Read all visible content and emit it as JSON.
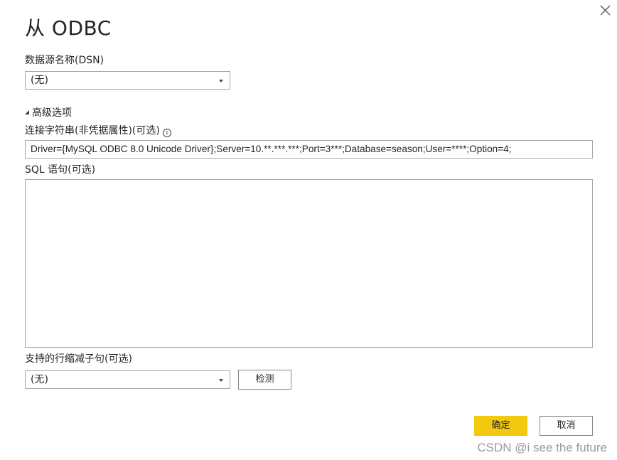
{
  "dialog": {
    "title": "从 ODBC",
    "close_icon": "close-icon"
  },
  "dsn": {
    "label": "数据源名称(DSN)",
    "selected": "(无)"
  },
  "advanced": {
    "toggle_label": "高级选项",
    "expanded": true,
    "connection_string": {
      "label": "连接字符串(非凭据属性)(可选)",
      "info_icon": "info-icon",
      "info_glyph": "i",
      "value": "Driver={MySQL ODBC 8.0 Unicode Driver};Server=10.**.***.***;Port=3***;Database=season;User=****;Option=4;"
    },
    "sql": {
      "label": "SQL 语句(可选)",
      "value": ""
    },
    "row_reduction": {
      "label": "支持的行缩减子句(可选)",
      "selected": "(无)",
      "detect_label": "检测"
    }
  },
  "footer": {
    "ok_label": "确定",
    "cancel_label": "取消"
  },
  "watermark": "CSDN @i see the future",
  "colors": {
    "primary": "#f2c811",
    "border": "#a6a6a6",
    "text": "#252423"
  }
}
